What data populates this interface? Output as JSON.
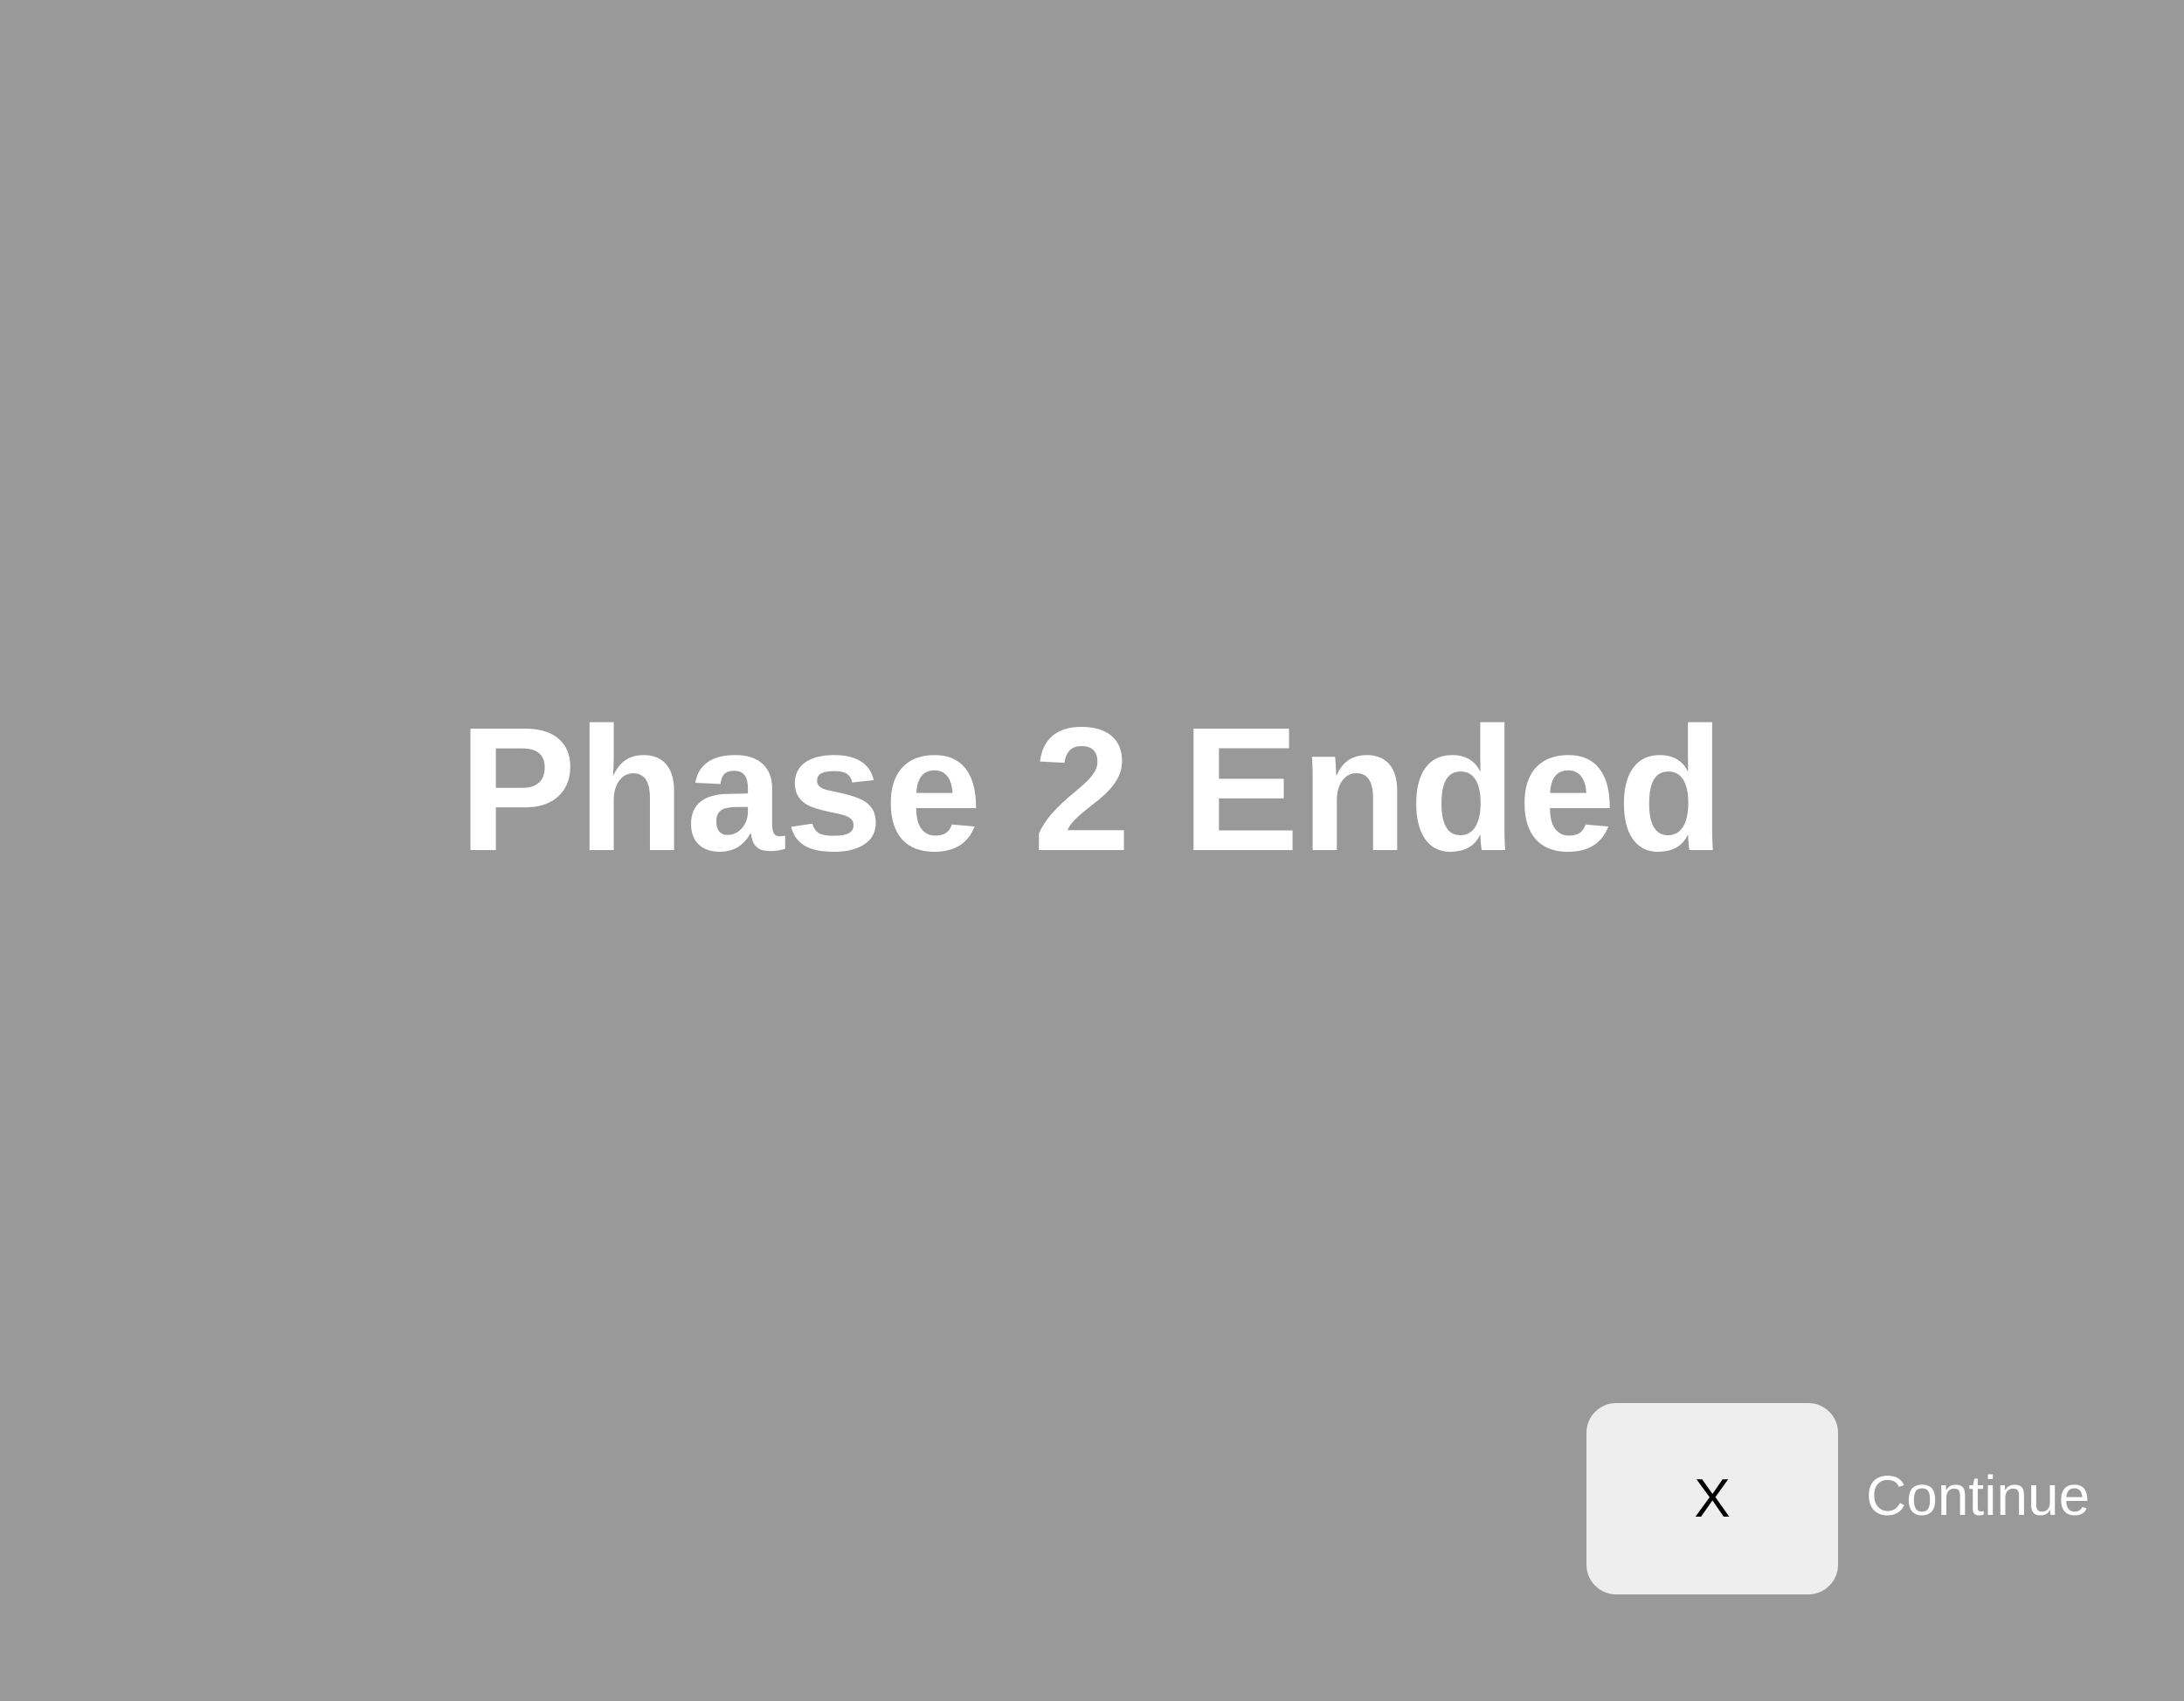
{
  "screen": {
    "background_color": "#999999",
    "title": "Phase 2 Ended",
    "title_color": "#ffffff"
  },
  "continue_prompt": {
    "key": "X",
    "key_box_color": "#eeeeee",
    "label": "Continue",
    "label_color": "#ffffff"
  }
}
